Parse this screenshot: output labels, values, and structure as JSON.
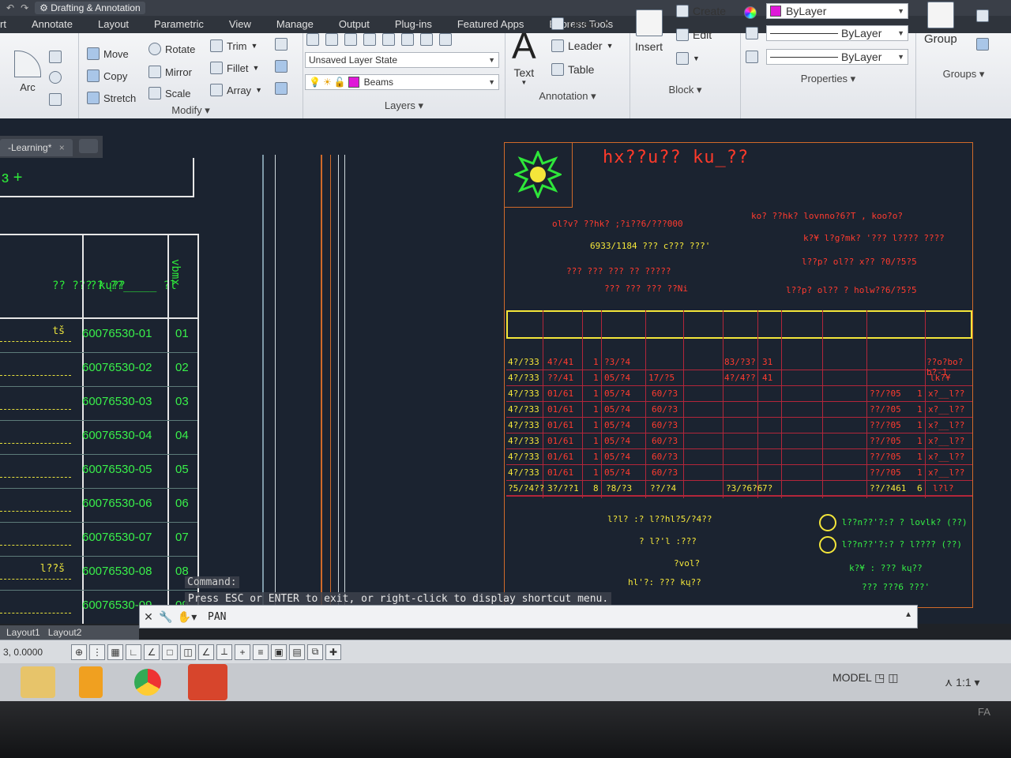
{
  "titlebar": {
    "workspace": "Drafting & Annotation"
  },
  "tabs": [
    "rt",
    "Annotate",
    "Layout",
    "Parametric",
    "View",
    "Manage",
    "Output",
    "Plug-ins",
    "Featured Apps",
    "Express Tools"
  ],
  "draw_panel": {
    "arc": "Arc"
  },
  "modify_panel": {
    "title": "Modify",
    "items": [
      "Move",
      "Rotate",
      "Trim",
      "Copy",
      "Mirror",
      "Fillet",
      "Stretch",
      "Scale",
      "Array"
    ]
  },
  "layers_panel": {
    "title": "Layers",
    "layer_state": "Unsaved Layer State",
    "current_layer": "Beams"
  },
  "annotation_panel": {
    "title": "Annotation",
    "text": "Text",
    "linear": "Linear",
    "leader": "Leader",
    "table": "Table"
  },
  "block_panel": {
    "title": "Block",
    "insert": "Insert",
    "create": "Create",
    "edit": "Edit"
  },
  "properties_panel": {
    "title": "Properties",
    "color": "ByLayer",
    "linetype": "ByLayer",
    "lineweight": "ByLayer"
  },
  "groups_panel": {
    "title": "Groups",
    "group": "Group"
  },
  "file_tab": "-Learning*",
  "left_table": {
    "header": [
      "?? ??? kų??",
      "?? ??_____ ?l",
      "vbmx"
    ],
    "rows": [
      {
        "name": "tš",
        "code": "60076530-01",
        "num": "01"
      },
      {
        "name": "",
        "code": "60076530-02",
        "num": "02"
      },
      {
        "name": "",
        "code": "60076530-03",
        "num": "03"
      },
      {
        "name": "",
        "code": "60076530-04",
        "num": "04"
      },
      {
        "name": "",
        "code": "60076530-05",
        "num": "05"
      },
      {
        "name": "",
        "code": "60076530-06",
        "num": "06"
      },
      {
        "name": "",
        "code": "60076530-07",
        "num": "07"
      },
      {
        "name": "l??š",
        "code": "60076530-08",
        "num": "08"
      },
      {
        "name": "",
        "code": "60076530-09",
        "num": "09"
      }
    ]
  },
  "sheet": {
    "title": "hx??u?? ku_??",
    "info_left": [
      "ol?v? ??hk? ;?i??6/???000",
      "6933/1184 ??? c??? ???'",
      "??? ??? ??? ?? ?????",
      "??? ??? ??? ??Ni"
    ],
    "info_right": [
      "ko? ??hk? lovnno?6?T , koo?o?",
      "k?¥ l?g?mk? '??? l???? ????",
      "l??p? ol?? x?? ?0/?5?5",
      "l??p? ol?? ? holw??6/?5?5"
    ],
    "table_rows": [
      [
        "??o?bo?b?-1",
        "",
        "",
        "",
        "31",
        "83/?3?",
        "",
        "1",
        "?3/?4",
        "4?/41",
        "4?/?33"
      ],
      [
        "lk?¥",
        "",
        "",
        "",
        "41",
        "4?/4??",
        "17/?5",
        "1",
        "05/?4",
        "??/41",
        "4?/?33"
      ],
      [
        "x?__l??",
        "1",
        "??/?05",
        "",
        "",
        "",
        "60/?3",
        "1",
        "05/?4",
        "01/61",
        "4?/?33"
      ],
      [
        "x?__l??",
        "1",
        "??/?05",
        "",
        "",
        "",
        "60/?3",
        "1",
        "05/?4",
        "01/61",
        "4?/?33"
      ],
      [
        "x?__l??",
        "1",
        "??/?05",
        "",
        "",
        "",
        "60/?3",
        "1",
        "05/?4",
        "01/61",
        "4?/?33"
      ],
      [
        "x?__l??",
        "1",
        "??/?05",
        "",
        "",
        "",
        "60/?3",
        "1",
        "05/?4",
        "01/61",
        "4?/?33"
      ],
      [
        "x?__l??",
        "1",
        "??/?05",
        "",
        "",
        "",
        "60/?3",
        "1",
        "05/?4",
        "01/61",
        "4?/?33"
      ],
      [
        "x?__l??",
        "1",
        "??/?05",
        "",
        "",
        "",
        "60/?3",
        "1",
        "05/?4",
        "01/61",
        "4?/?33"
      ],
      [
        "l?l?",
        "6",
        "??/?461",
        "7?",
        "?3/?6?6",
        "",
        "??/?4",
        "8",
        "?8/?3",
        "3?/??1",
        "?5/?4??"
      ]
    ],
    "footer_left": [
      "l?l? :? l??hl?5/?4??",
      "? l?'l :???",
      "?vol?",
      "hl'?: ??? kų??"
    ],
    "footer_right": [
      "l??n??'?:? ? lovlk? (??)",
      "l??n??'?:? ? l???? (??)",
      "k?¥ : ??? kų??",
      "??? ???6 ???'"
    ]
  },
  "command": {
    "label": "Command:",
    "message": "Press ESC or ENTER to exit, or right-click to display shortcut menu.",
    "current": "PAN"
  },
  "layout_tabs": [
    "Layout1",
    "Layout2"
  ],
  "status": {
    "coords": "3, 0.0000",
    "space": "MODEL",
    "scale": "1:1"
  },
  "tray": {
    "lang": "FA"
  }
}
